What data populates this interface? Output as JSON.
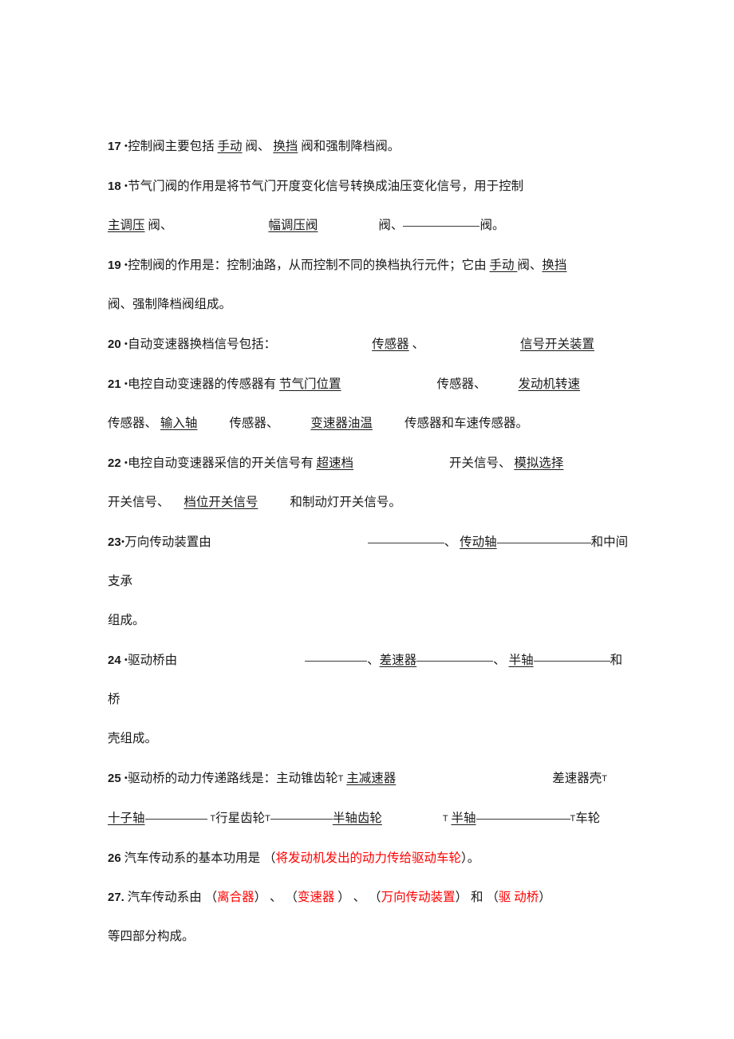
{
  "document": {
    "type": "exam-fill-in-the-blank-worksheet",
    "subject_language": "zh-CN",
    "background_color": "#ffffff",
    "text_color": "#1a1a1a",
    "answer_color": "#ff0000",
    "blank_rule_color": "#3a3a3a"
  },
  "items": [
    {
      "number": "17",
      "marker": "•",
      "lines": [
        {
          "segments": [
            {
              "text": "控制阀主要包括 ",
              "style": "plain"
            },
            {
              "text": "手动",
              "style": "underline"
            },
            {
              "text": " 阀、 ",
              "style": "plain"
            },
            {
              "text": "换挡",
              "style": "underline"
            },
            {
              "text": " 阀和强制降档阀。",
              "style": "plain"
            }
          ]
        }
      ]
    },
    {
      "number": "18",
      "marker": "•",
      "lines": [
        {
          "segments": [
            {
              "text": "节气门阀的作用是将节气门开度变化信号转换成油压变化信号，用于控制",
              "style": "plain"
            }
          ]
        },
        {
          "segments": [
            {
              "text": "主调压",
              "style": "underline"
            },
            {
              "text": " 阀、",
              "style": "plain"
            },
            {
              "text": "",
              "style": "gap-xl"
            },
            {
              "text": "幅调压阀",
              "style": "underline"
            },
            {
              "text": "",
              "style": "gap-l"
            },
            {
              "text": "阀、",
              "style": "plain"
            },
            {
              "text": "",
              "style": "blank-lg"
            },
            {
              "text": "阀。",
              "style": "plain"
            }
          ]
        }
      ]
    },
    {
      "number": "19",
      "marker": "•",
      "lines": [
        {
          "segments": [
            {
              "text": "控制阀的作用是：控制油路，从而控制不同的换档执行元件；它由 ",
              "style": "plain"
            },
            {
              "text": "手动 ",
              "style": "underline"
            },
            {
              "text": "阀、",
              "style": "plain"
            },
            {
              "text": "换挡",
              "style": "underline"
            }
          ]
        },
        {
          "segments": [
            {
              "text": "阀、强制降档阀组成。",
              "style": "plain"
            }
          ]
        }
      ]
    },
    {
      "number": "20",
      "marker": "•",
      "lines": [
        {
          "segments": [
            {
              "text": "自动变速器换档信号包括：",
              "style": "plain"
            },
            {
              "text": "",
              "style": "gap-xl"
            },
            {
              "text": "传感器",
              "style": "underline"
            },
            {
              "text": " 、",
              "style": "plain"
            },
            {
              "text": "",
              "style": "gap-xl"
            },
            {
              "text": "信号开关装置",
              "style": "underline"
            }
          ]
        }
      ]
    },
    {
      "number": "21",
      "marker": "•",
      "lines": [
        {
          "segments": [
            {
              "text": "电控自动变速器的传感器有 ",
              "style": "plain"
            },
            {
              "text": "节气门位置",
              "style": "underline"
            },
            {
              "text": "",
              "style": "gap-xl"
            },
            {
              "text": "传感器、",
              "style": "plain"
            },
            {
              "text": "",
              "style": "gap-m"
            },
            {
              "text": "发动机转速",
              "style": "underline"
            }
          ]
        },
        {
          "segments": [
            {
              "text": "传感器、 ",
              "style": "plain"
            },
            {
              "text": "输入轴",
              "style": "underline"
            },
            {
              "text": "",
              "style": "gap-m"
            },
            {
              "text": "传感器、",
              "style": "plain"
            },
            {
              "text": "",
              "style": "gap-m"
            },
            {
              "text": "变速器油温",
              "style": "underline"
            },
            {
              "text": "",
              "style": "gap-m"
            },
            {
              "text": "传感器和车速传感器。",
              "style": "plain"
            }
          ]
        }
      ]
    },
    {
      "number": "22",
      "marker": "•",
      "lines": [
        {
          "segments": [
            {
              "text": "电控自动变速器采信的开关信号有 ",
              "style": "plain"
            },
            {
              "text": "超速档",
              "style": "underline"
            },
            {
              "text": "",
              "style": "gap-xl"
            },
            {
              "text": "开关信号、 ",
              "style": "plain"
            },
            {
              "text": "模拟选择",
              "style": "underline"
            }
          ]
        },
        {
          "segments": [
            {
              "text": "开关信号、 ",
              "style": "plain"
            },
            {
              "text": "",
              "style": "gap-s"
            },
            {
              "text": "档位开关信号",
              "style": "underline"
            },
            {
              "text": "",
              "style": "gap-m"
            },
            {
              "text": "和制动灯开关信号。",
              "style": "plain"
            }
          ]
        }
      ]
    },
    {
      "number": "23",
      "marker": "•",
      "lines": [
        {
          "segments": [
            {
              "text": "万向传动装置由",
              "style": "plain"
            },
            {
              "text": "",
              "style": "gap-xl"
            },
            {
              "text": "",
              "style": "gap-l"
            },
            {
              "text": "",
              "style": "blank-lg"
            },
            {
              "text": "、 ",
              "style": "plain"
            },
            {
              "text": "传动轴",
              "style": "underline"
            },
            {
              "text": "",
              "style": "blank-xl"
            },
            {
              "text": "和中间支承",
              "style": "plain"
            }
          ]
        },
        {
          "segments": [
            {
              "text": "组成。",
              "style": "plain"
            }
          ]
        }
      ]
    },
    {
      "number": "24",
      "marker": "•",
      "lines": [
        {
          "segments": [
            {
              "text": "驱动桥由",
              "style": "plain"
            },
            {
              "text": "",
              "style": "gap-xl"
            },
            {
              "text": "",
              "style": "gap-m"
            },
            {
              "text": "",
              "style": "blank-md"
            },
            {
              "text": "、",
              "style": "plain"
            },
            {
              "text": "差速器",
              "style": "underline"
            },
            {
              "text": "",
              "style": "blank-lg"
            },
            {
              "text": "、 ",
              "style": "plain"
            },
            {
              "text": "半轴",
              "style": "underline"
            },
            {
              "text": "",
              "style": "blank-lg"
            },
            {
              "text": "和桥",
              "style": "plain"
            }
          ]
        },
        {
          "segments": [
            {
              "text": "壳组成。",
              "style": "plain"
            }
          ]
        }
      ]
    },
    {
      "number": "25",
      "marker": "•",
      "lines": [
        {
          "segments": [
            {
              "text": "驱动桥的动力传递路线是：主动锥齿轮",
              "style": "plain"
            },
            {
              "text": "T",
              "style": "arrow"
            },
            {
              "text": " ",
              "style": "plain"
            },
            {
              "text": "主减速器",
              "style": "underline"
            },
            {
              "text": "",
              "style": "gap-xl"
            },
            {
              "text": "",
              "style": "gap-l"
            },
            {
              "text": "差速器壳",
              "style": "plain"
            },
            {
              "text": "T",
              "style": "arrow"
            }
          ]
        },
        {
          "segments": [
            {
              "text": "十子轴",
              "style": "underline"
            },
            {
              "text": "",
              "style": "blank-md"
            },
            {
              "text": " ",
              "style": "plain"
            },
            {
              "text": "T",
              "style": "arrow"
            },
            {
              "text": "行星齿轮",
              "style": "plain"
            },
            {
              "text": "T",
              "style": "arrow"
            },
            {
              "text": "",
              "style": "blank-md"
            },
            {
              "text": "半轴齿轮",
              "style": "underline"
            },
            {
              "text": "",
              "style": "gap-l"
            },
            {
              "text": "T",
              "style": "arrow"
            },
            {
              "text": " ",
              "style": "plain"
            },
            {
              "text": "半轴",
              "style": "underline"
            },
            {
              "text": "",
              "style": "blank-xl"
            },
            {
              "text": "T",
              "style": "arrow"
            },
            {
              "text": "车轮",
              "style": "plain"
            }
          ]
        }
      ]
    },
    {
      "number": "26",
      "marker": "",
      "lines": [
        {
          "segments": [
            {
              "text": "汽车传动系的基本功用是 （",
              "style": "plain"
            },
            {
              "text": "将发动机发出的动力传给驱动车轮",
              "style": "red"
            },
            {
              "text": "）。",
              "style": "plain"
            }
          ]
        }
      ]
    },
    {
      "number": "27.",
      "marker": "",
      "lines": [
        {
          "segments": [
            {
              "text": "汽车传动系由 （",
              "style": "plain"
            },
            {
              "text": "离合器",
              "style": "red"
            },
            {
              "text": "） 、 （",
              "style": "plain"
            },
            {
              "text": "变速器 ",
              "style": "red"
            },
            {
              "text": "） 、 （",
              "style": "plain"
            },
            {
              "text": "万向传动装置",
              "style": "red"
            },
            {
              "text": "） 和 （",
              "style": "plain"
            },
            {
              "text": "驱 动桥",
              "style": "red"
            },
            {
              "text": "）",
              "style": "plain"
            }
          ]
        },
        {
          "segments": [
            {
              "text": "等四部分构成。",
              "style": "plain"
            }
          ]
        }
      ]
    }
  ]
}
